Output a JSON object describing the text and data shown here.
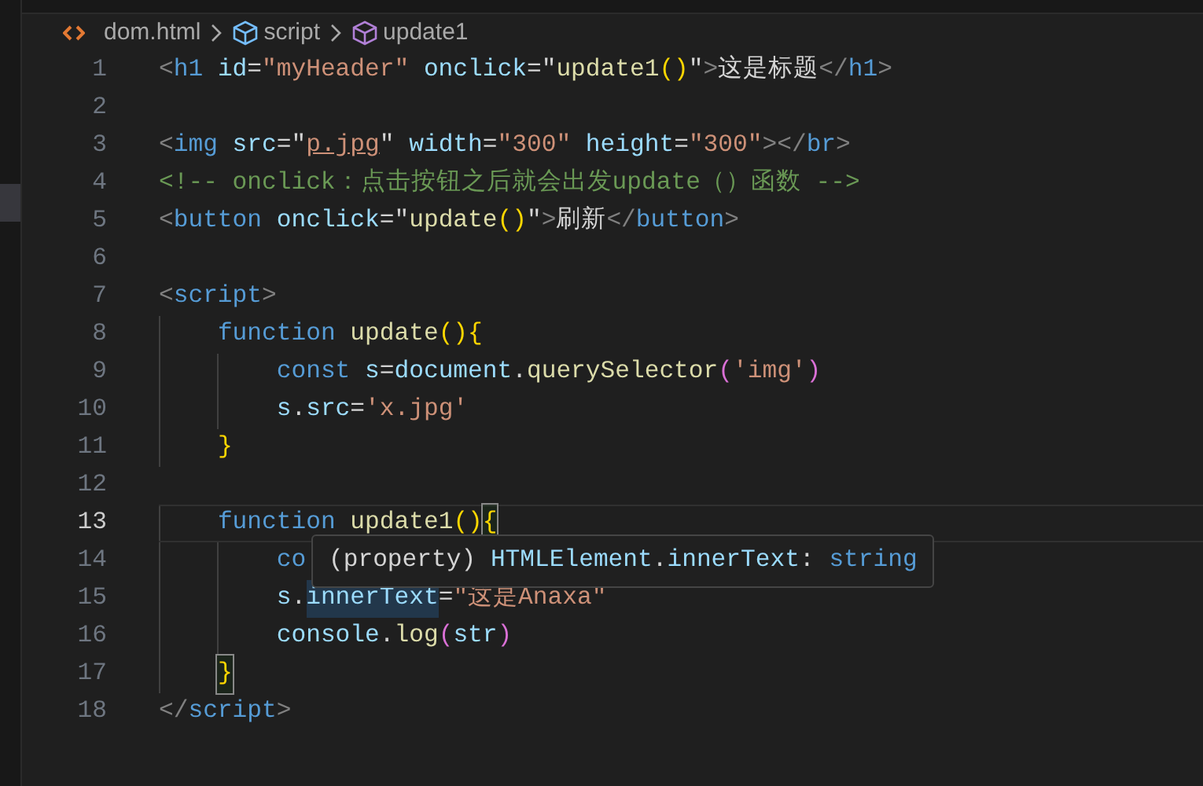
{
  "breadcrumb": [
    {
      "label": "dom.html",
      "kind": "file"
    },
    {
      "label": "script",
      "kind": "module"
    },
    {
      "label": "update1",
      "kind": "function"
    }
  ],
  "lines": [
    {
      "number": "1",
      "active": false,
      "tokens": [
        {
          "text": "<",
          "kind": "punct"
        },
        {
          "text": "h1",
          "kind": "tag"
        },
        {
          "text": " id",
          "kind": "attr"
        },
        {
          "text": "=",
          "kind": "text"
        },
        {
          "text": "\"myHeader\"",
          "kind": "string"
        },
        {
          "text": " onclick",
          "kind": "attr"
        },
        {
          "text": "=\"",
          "kind": "text"
        },
        {
          "text": "update1",
          "kind": "func"
        },
        {
          "text": "()",
          "kind": "bracket"
        },
        {
          "text": "\"",
          "kind": "text"
        },
        {
          "text": ">",
          "kind": "punct"
        },
        {
          "text": "这是标题",
          "kind": "text"
        },
        {
          "text": "</",
          "kind": "punct"
        },
        {
          "text": "h1",
          "kind": "tag"
        },
        {
          "text": ">",
          "kind": "punct"
        }
      ]
    },
    {
      "number": "2",
      "active": false
    },
    {
      "number": "3",
      "active": false,
      "tokens": [
        {
          "text": "<",
          "kind": "punct"
        },
        {
          "text": "img",
          "kind": "tag"
        },
        {
          "text": " src",
          "kind": "attr"
        },
        {
          "text": "=\"",
          "kind": "text"
        },
        {
          "text": "p.jpg",
          "kind": "link"
        },
        {
          "text": "\"",
          "kind": "text"
        },
        {
          "text": " width",
          "kind": "attr"
        },
        {
          "text": "=",
          "kind": "text"
        },
        {
          "text": "\"300\"",
          "kind": "string"
        },
        {
          "text": " height",
          "kind": "attr"
        },
        {
          "text": "=",
          "kind": "text"
        },
        {
          "text": "\"300\"",
          "kind": "string"
        },
        {
          "text": "></",
          "kind": "punct"
        },
        {
          "text": "br",
          "kind": "tag"
        },
        {
          "text": ">",
          "kind": "punct"
        }
      ]
    },
    {
      "number": "4",
      "active": false,
      "tokens": [
        {
          "text": "<!-- onclick：点击按钮之后就会出发update（）函数 -->",
          "kind": "comment"
        }
      ]
    },
    {
      "number": "5",
      "active": false,
      "tokens": [
        {
          "text": "<",
          "kind": "punct"
        },
        {
          "text": "button",
          "kind": "tag"
        },
        {
          "text": " onclick",
          "kind": "attr"
        },
        {
          "text": "=\"",
          "kind": "text"
        },
        {
          "text": "update",
          "kind": "func"
        },
        {
          "text": "()",
          "kind": "bracket"
        },
        {
          "text": "\"",
          "kind": "text"
        },
        {
          "text": ">",
          "kind": "punct"
        },
        {
          "text": "刷新",
          "kind": "text"
        },
        {
          "text": "</",
          "kind": "punct"
        },
        {
          "text": "button",
          "kind": "tag"
        },
        {
          "text": ">",
          "kind": "punct"
        }
      ]
    },
    {
      "number": "6",
      "active": false
    },
    {
      "number": "7",
      "active": false,
      "tokens": [
        {
          "text": "<",
          "kind": "punct"
        },
        {
          "text": "script",
          "kind": "tag"
        },
        {
          "text": ">",
          "kind": "punct"
        }
      ]
    },
    {
      "number": "8",
      "active": false,
      "tokens": [
        {
          "text": "    function",
          "kind": "keyword"
        },
        {
          "text": " update",
          "kind": "func"
        },
        {
          "text": "(){",
          "kind": "bracket"
        }
      ]
    },
    {
      "number": "9",
      "active": false,
      "tokens": [
        {
          "text": "        const",
          "kind": "keyword"
        },
        {
          "text": " s",
          "kind": "var"
        },
        {
          "text": "=",
          "kind": "text"
        },
        {
          "text": "document",
          "kind": "var"
        },
        {
          "text": ".",
          "kind": "text"
        },
        {
          "text": "querySelector",
          "kind": "func"
        },
        {
          "text": "(",
          "kind": "bracket2"
        },
        {
          "text": "'img'",
          "kind": "string"
        },
        {
          "text": ")",
          "kind": "bracket2"
        }
      ]
    },
    {
      "number": "10",
      "active": false,
      "tokens": [
        {
          "text": "        s",
          "kind": "var"
        },
        {
          "text": ".",
          "kind": "text"
        },
        {
          "text": "src",
          "kind": "var"
        },
        {
          "text": "=",
          "kind": "text"
        },
        {
          "text": "'x.jpg'",
          "kind": "string"
        }
      ]
    },
    {
      "number": "11",
      "active": false,
      "tokens": [
        {
          "text": "    }",
          "kind": "bracket"
        }
      ]
    },
    {
      "number": "12",
      "active": false
    },
    {
      "number": "13",
      "active": true,
      "tokens": [
        {
          "text": "    function",
          "kind": "keyword"
        },
        {
          "text": " update1",
          "kind": "func"
        },
        {
          "text": "()",
          "kind": "bracket"
        },
        {
          "text": "{",
          "kind": "bracket",
          "matched": true
        }
      ]
    },
    {
      "number": "14",
      "active": false,
      "tokens": [
        {
          "text": "        co",
          "kind": "keyword"
        }
      ]
    },
    {
      "number": "15",
      "active": false,
      "tokens": [
        {
          "text": "        s",
          "kind": "var"
        },
        {
          "text": ".",
          "kind": "text"
        },
        {
          "text": "innerText",
          "kind": "var",
          "highlighted": true
        },
        {
          "text": "=",
          "kind": "text"
        },
        {
          "text": "\"这是Anaxa\"",
          "kind": "string"
        }
      ]
    },
    {
      "number": "16",
      "active": false,
      "tokens": [
        {
          "text": "        console",
          "kind": "var"
        },
        {
          "text": ".",
          "kind": "text"
        },
        {
          "text": "log",
          "kind": "func"
        },
        {
          "text": "(",
          "kind": "bracket2"
        },
        {
          "text": "str",
          "kind": "var"
        },
        {
          "text": ")",
          "kind": "bracket2"
        }
      ]
    },
    {
      "number": "17",
      "active": false,
      "tokens": [
        {
          "text": "    }",
          "kind": "bracket",
          "matched": true
        }
      ]
    },
    {
      "number": "18",
      "active": false,
      "tokens": [
        {
          "text": "</",
          "kind": "punct"
        },
        {
          "text": "script",
          "kind": "tag"
        },
        {
          "text": ">",
          "kind": "punct"
        }
      ]
    }
  ],
  "hover": {
    "tokens": [
      {
        "text": "(property)",
        "kind": "text"
      },
      {
        "text": " HTMLElement",
        "kind": "var"
      },
      {
        "text": ".",
        "kind": "text"
      },
      {
        "text": "innerText",
        "kind": "var"
      },
      {
        "text": ":",
        "kind": "text"
      },
      {
        "text": " string",
        "kind": "keyword"
      }
    ]
  }
}
